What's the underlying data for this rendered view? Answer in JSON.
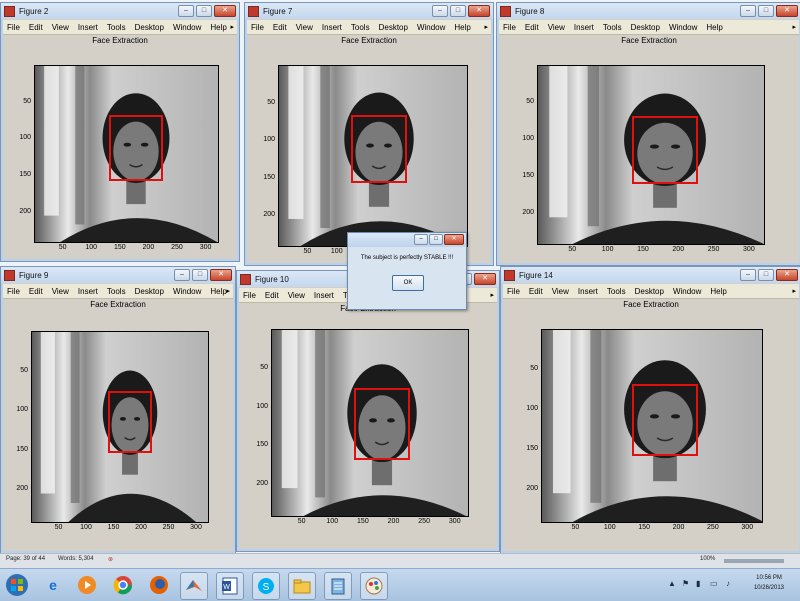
{
  "menu": [
    "File",
    "Edit",
    "View",
    "Insert",
    "Tools",
    "Desktop",
    "Window",
    "Help"
  ],
  "plot_title": "Face Extraction",
  "yticks": [
    "50",
    "100",
    "150",
    "200"
  ],
  "xticks": [
    "50",
    "100",
    "150",
    "200",
    "250",
    "300"
  ],
  "figures": [
    {
      "title": "Figure 2"
    },
    {
      "title": "Figure 7"
    },
    {
      "title": "Figure 8"
    },
    {
      "title": "Figure 9"
    },
    {
      "title": "Figure 10"
    },
    {
      "title": "Figure 14"
    }
  ],
  "dialog": {
    "message": "The subject is perfectly STABLE !!!",
    "ok_label": "OK"
  },
  "status": {
    "page": "Page: 39 of 44",
    "words": "Words: 5,304",
    "zoom": "100%"
  },
  "clock": {
    "time": "10:56 PM",
    "date": "10/26/2013"
  },
  "colors": {
    "face_box": "#e01010",
    "title_bar": "#c3d7ee",
    "taskbar": "#a8c3e0"
  },
  "taskbar_icons": [
    "windows-start-icon",
    "ie-icon",
    "media-player-icon",
    "chrome-icon",
    "firefox-icon",
    "matlab-icon",
    "word-icon",
    "skype-icon",
    "folder-icon",
    "notepad-icon",
    "paint-icon"
  ]
}
